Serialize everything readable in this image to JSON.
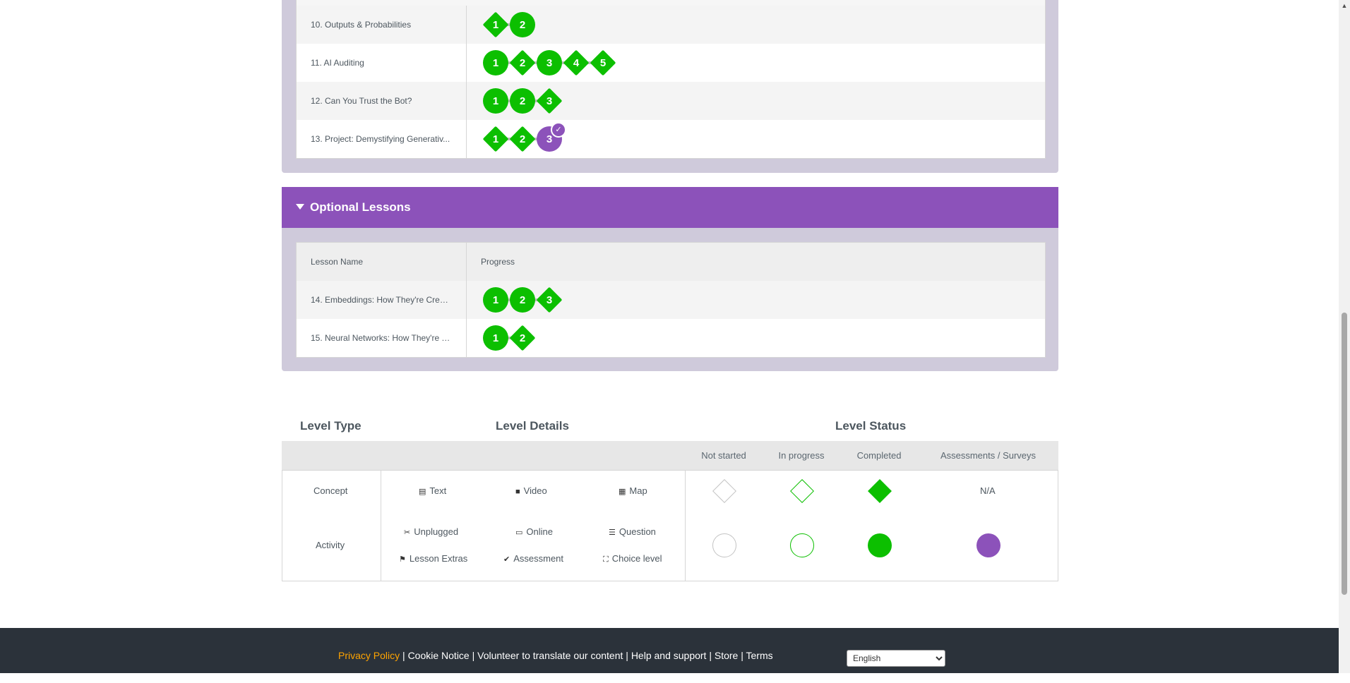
{
  "main_lessons": [
    {
      "name": "10. Outputs & Probabilities",
      "levels": [
        {
          "n": "1",
          "shape": "diamond"
        },
        {
          "n": "2",
          "shape": "circle"
        }
      ]
    },
    {
      "name": "11. AI Auditing",
      "levels": [
        {
          "n": "1",
          "shape": "circle"
        },
        {
          "n": "2",
          "shape": "diamond"
        },
        {
          "n": "3",
          "shape": "circle"
        },
        {
          "n": "4",
          "shape": "diamond"
        },
        {
          "n": "5",
          "shape": "diamond"
        }
      ]
    },
    {
      "name": "12. Can You Trust the Bot?",
      "levels": [
        {
          "n": "1",
          "shape": "circle"
        },
        {
          "n": "2",
          "shape": "circle"
        },
        {
          "n": "3",
          "shape": "diamond"
        }
      ]
    },
    {
      "name": "13. Project: Demystifying Generativ...",
      "levels": [
        {
          "n": "1",
          "shape": "diamond"
        },
        {
          "n": "2",
          "shape": "diamond"
        },
        {
          "n": "3",
          "shape": "circle",
          "status": "assessment"
        }
      ]
    }
  ],
  "optional": {
    "title": "Optional Lessons",
    "col_lesson": "Lesson Name",
    "col_progress": "Progress",
    "lessons": [
      {
        "name": "14. Embeddings: How They're Creat...",
        "levels": [
          {
            "n": "1",
            "shape": "circle"
          },
          {
            "n": "2",
            "shape": "circle"
          },
          {
            "n": "3",
            "shape": "diamond"
          }
        ]
      },
      {
        "name": "15. Neural Networks: How They're T...",
        "levels": [
          {
            "n": "1",
            "shape": "circle"
          },
          {
            "n": "2",
            "shape": "diamond"
          }
        ]
      }
    ]
  },
  "key": {
    "level_type": "Level Type",
    "level_details": "Level Details",
    "level_status": "Level Status",
    "status_cols": [
      "Not started",
      "In progress",
      "Completed",
      "Assessments / Surveys"
    ],
    "concept": {
      "label": "Concept",
      "details": [
        {
          "icon": "document-icon",
          "glyph": "▤",
          "text": "Text"
        },
        {
          "icon": "video-icon",
          "glyph": "■",
          "text": "Video"
        },
        {
          "icon": "map-icon",
          "glyph": "▦",
          "text": "Map"
        }
      ],
      "na": "N/A"
    },
    "activity": {
      "label": "Activity",
      "details": [
        {
          "icon": "scissors-icon",
          "glyph": "✂",
          "text": "Unplugged"
        },
        {
          "icon": "desktop-icon",
          "glyph": "▭",
          "text": "Online"
        },
        {
          "icon": "list-icon",
          "glyph": "☰",
          "text": "Question"
        },
        {
          "icon": "flag-icon",
          "glyph": "⚑",
          "text": "Lesson Extras"
        },
        {
          "icon": "check-circle-icon",
          "glyph": "✔",
          "text": "Assessment"
        },
        {
          "icon": "sitemap-icon",
          "glyph": "⛶",
          "text": "Choice level"
        }
      ]
    }
  },
  "footer": {
    "links": [
      "Privacy Policy",
      "Cookie Notice",
      "Volunteer to translate our content",
      "Help and support",
      "Store",
      "Terms"
    ],
    "language": "English"
  },
  "colors": {
    "green": "#0cbf00",
    "purple": "#8c52ba",
    "footer_bg": "#2b323a",
    "privacy_link": "#ffa400"
  }
}
